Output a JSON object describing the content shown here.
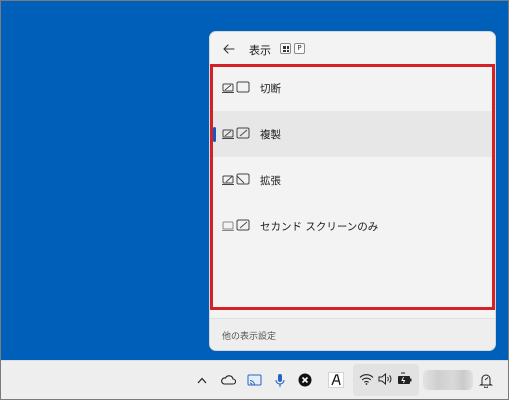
{
  "flyout": {
    "title": "表示",
    "key_hints": [
      "⊞",
      "P"
    ],
    "options": [
      {
        "label": "切断",
        "icon": "disconnect-icon",
        "selected": false
      },
      {
        "label": "複製",
        "icon": "duplicate-icon",
        "selected": true
      },
      {
        "label": "拡張",
        "icon": "extend-icon",
        "selected": false
      },
      {
        "label": "セカンド スクリーンのみ",
        "icon": "second-screen-only-icon",
        "selected": false
      }
    ],
    "footer_link": "他の表示設定"
  },
  "taskbar": {
    "icons": [
      "chevron-up-icon",
      "onedrive-icon",
      "cast-icon",
      "microphone-icon",
      "xbox-icon",
      "font-a-icon",
      "wifi-icon",
      "speaker-icon",
      "battery-icon",
      "notification-icon"
    ]
  },
  "colors": {
    "desktop": "#005fb8",
    "accent": "#0f5cc0",
    "highlight": "#d42027"
  }
}
